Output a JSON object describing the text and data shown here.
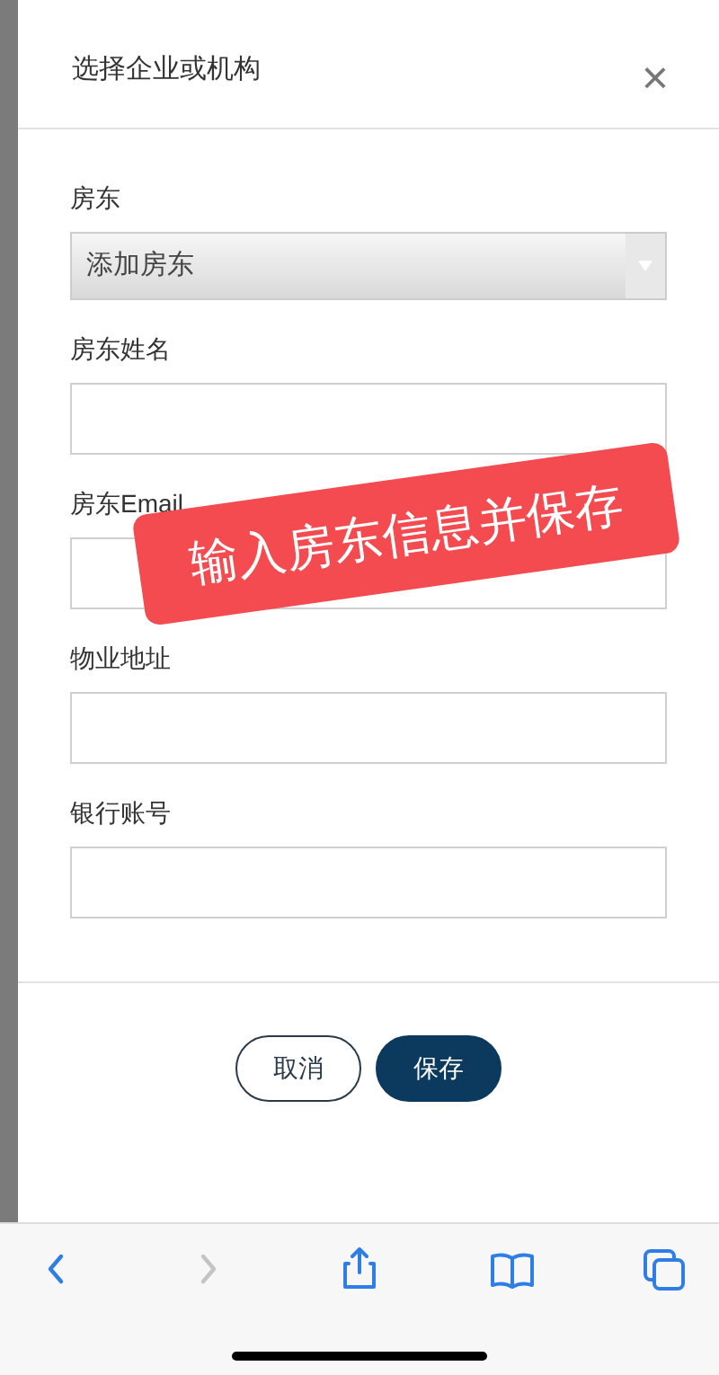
{
  "dialog": {
    "title": "选择企业或机构",
    "close": "×"
  },
  "select": {
    "label": "房东",
    "value": "添加房东"
  },
  "fields": [
    {
      "label": "房东姓名"
    },
    {
      "label": "房东Email"
    },
    {
      "label": "物业地址"
    },
    {
      "label": "银行账号"
    }
  ],
  "buttons": [
    {
      "label": "取消",
      "kind": "secondary"
    },
    {
      "label": "保存",
      "kind": "primary"
    }
  ],
  "annotation": {
    "text": "输入房东信息并保存"
  },
  "browser_toolbar": [
    {
      "kind": "back",
      "disabled": false
    },
    {
      "kind": "forward",
      "disabled": true
    },
    {
      "kind": "share",
      "disabled": false
    },
    {
      "kind": "bookmarks",
      "disabled": false
    },
    {
      "kind": "tabs",
      "disabled": false
    }
  ]
}
